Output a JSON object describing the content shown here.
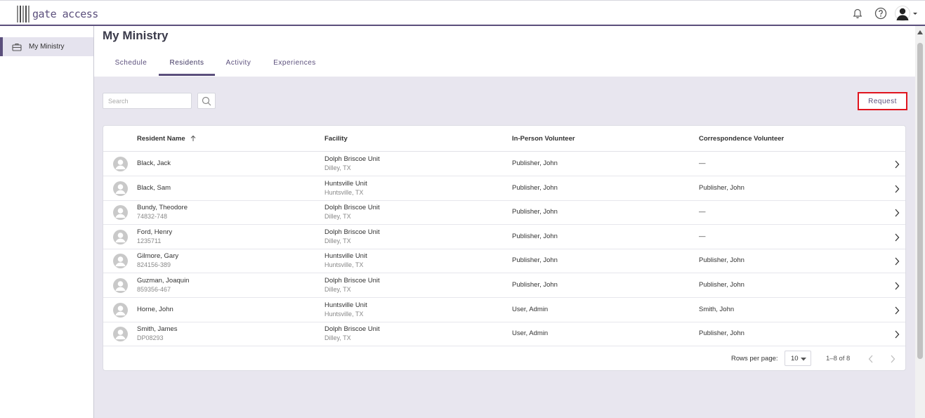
{
  "app": {
    "logo_text": "gate access"
  },
  "sidebar": {
    "items": [
      {
        "label": "My Ministry"
      }
    ]
  },
  "page": {
    "title": "My Ministry"
  },
  "tabs": [
    {
      "label": "Schedule"
    },
    {
      "label": "Residents"
    },
    {
      "label": "Activity"
    },
    {
      "label": "Experiences"
    }
  ],
  "search": {
    "placeholder": "Search"
  },
  "request_label": "Request",
  "table": {
    "columns": [
      "Resident Name",
      "Facility",
      "In-Person Volunteer",
      "Correspondence Volunteer"
    ],
    "rows": [
      {
        "name": "Black, Jack",
        "id": "",
        "facility": "Dolph Briscoe Unit",
        "location": "Dilley, TX",
        "in_person": "Publisher, John",
        "correspondence": "—"
      },
      {
        "name": "Black, Sam",
        "id": "",
        "facility": "Huntsville Unit",
        "location": "Huntsville, TX",
        "in_person": "Publisher, John",
        "correspondence": "Publisher, John"
      },
      {
        "name": "Bundy, Theodore",
        "id": "74832-748",
        "facility": "Dolph Briscoe Unit",
        "location": "Dilley, TX",
        "in_person": "Publisher, John",
        "correspondence": "—"
      },
      {
        "name": "Ford, Henry",
        "id": "1235711",
        "facility": "Dolph Briscoe Unit",
        "location": "Dilley, TX",
        "in_person": "Publisher, John",
        "correspondence": "—"
      },
      {
        "name": "Gilmore, Gary",
        "id": "824156-389",
        "facility": "Huntsville Unit",
        "location": "Huntsville, TX",
        "in_person": "Publisher, John",
        "correspondence": "Publisher, John"
      },
      {
        "name": "Guzman, Joaquin",
        "id": "859356-467",
        "facility": "Dolph Briscoe Unit",
        "location": "Dilley, TX",
        "in_person": "Publisher, John",
        "correspondence": "Publisher, John"
      },
      {
        "name": "Horne, John",
        "id": "",
        "facility": "Huntsville Unit",
        "location": "Huntsville, TX",
        "in_person": "User, Admin",
        "correspondence": "Smith, John"
      },
      {
        "name": "Smith, James",
        "id": "DP08293",
        "facility": "Dolph Briscoe Unit",
        "location": "Dilley, TX",
        "in_person": "User, Admin",
        "correspondence": "Publisher, John"
      }
    ]
  },
  "pagination": {
    "rows_per_page_label": "Rows per page:",
    "rows_per_page": "10",
    "range": "1–8 of 8"
  },
  "colors": {
    "accent": "#5b4f7c",
    "highlight": "#e0141e",
    "background": "#e8e6ef"
  }
}
